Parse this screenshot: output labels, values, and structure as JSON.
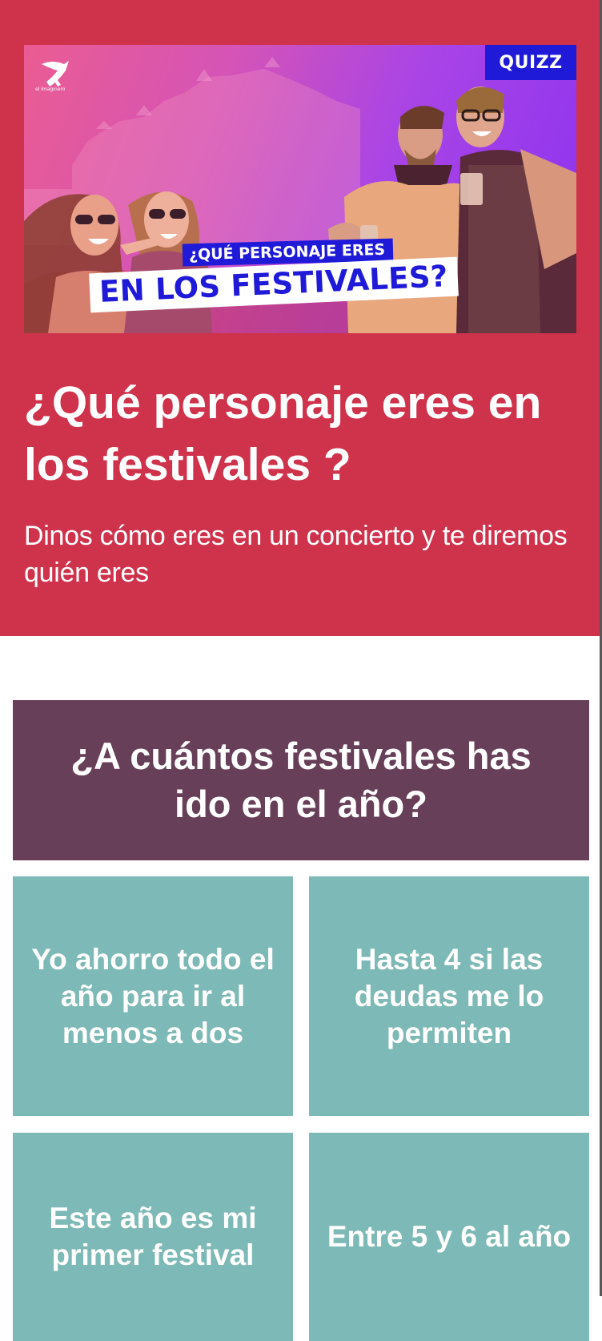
{
  "banner": {
    "badge": "QUIZZ",
    "logo_text": "el imaginero",
    "overlay_small": "¿QUÉ PERSONAJE ERES",
    "overlay_big": "EN LOS FESTIVALES?"
  },
  "quiz": {
    "title": "¿Qué personaje eres en los festivales ?",
    "subtitle": "Dinos cómo eres en un concierto y te diremos quién eres"
  },
  "question": {
    "text": "¿A cuántos festivales has ido en el año?",
    "answers": [
      {
        "label": "Yo ahorro todo el año para ir al menos a dos"
      },
      {
        "label": "Hasta 4 si las deudas me lo permiten"
      },
      {
        "label": "Este año es mi primer festival"
      },
      {
        "label": "Entre 5 y 6 al año"
      }
    ]
  },
  "colors": {
    "hero_bg": "#cf324b",
    "question_bg": "#673f58",
    "answer_bg": "#7db9b6",
    "badge_blue": "#1f1ad8"
  }
}
